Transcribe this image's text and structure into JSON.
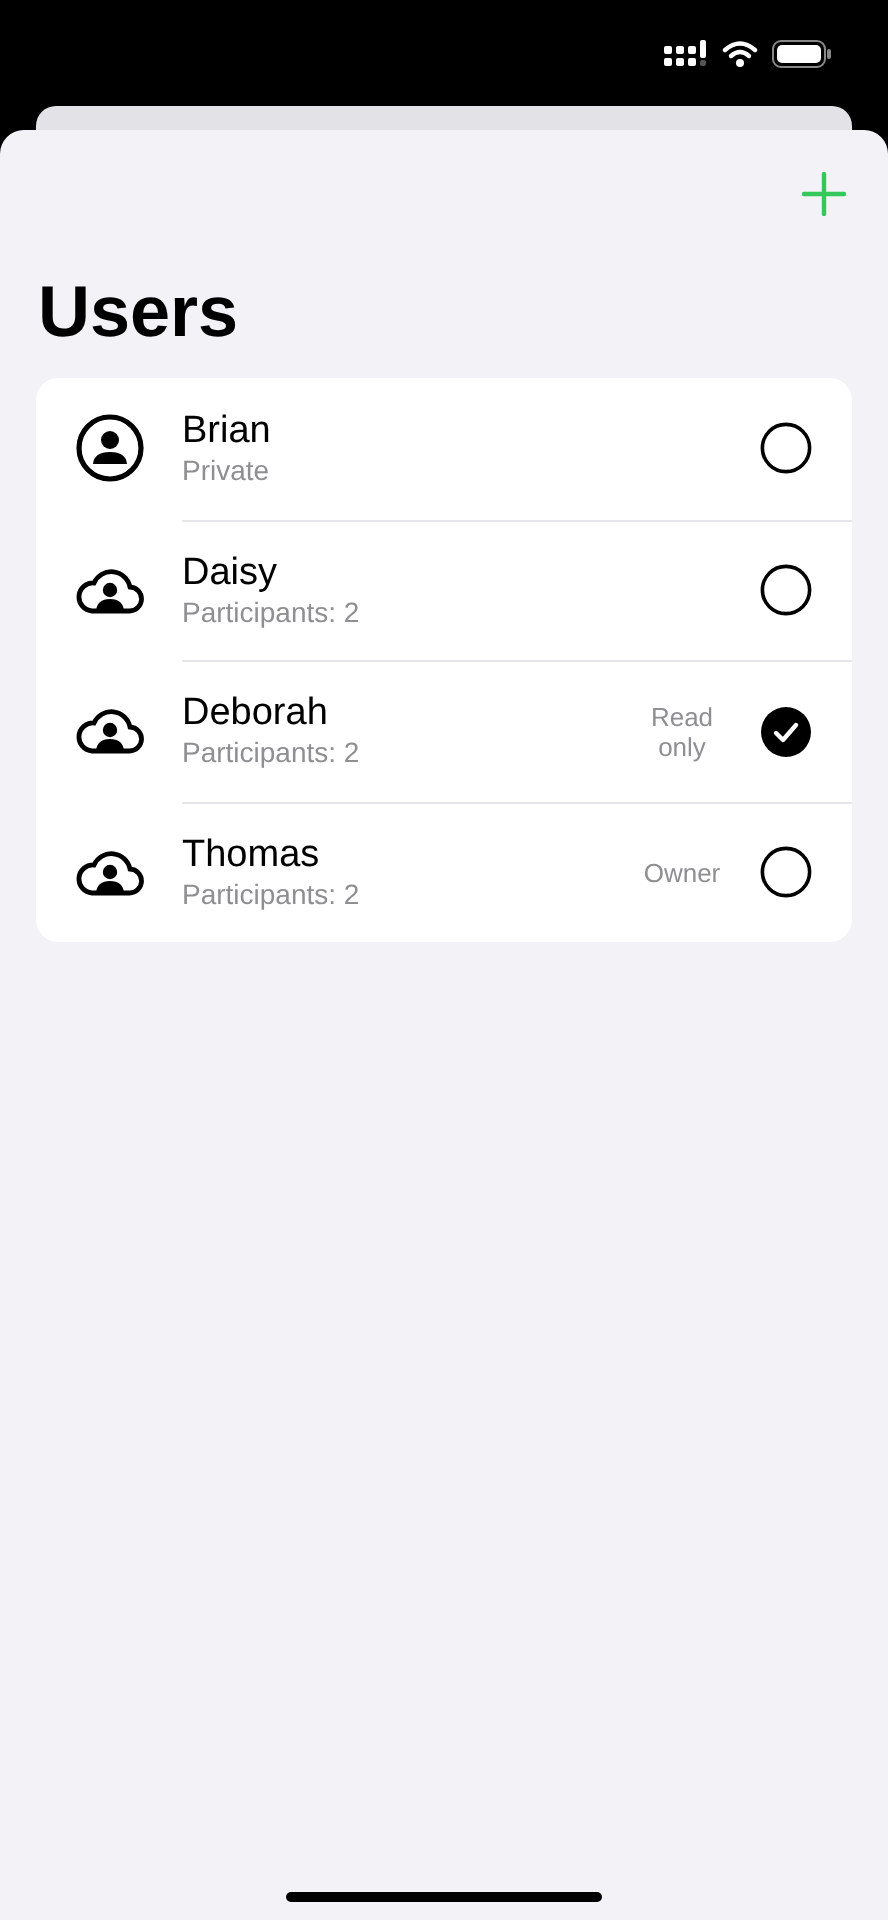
{
  "title": "Users",
  "users": [
    {
      "kind": "person",
      "name": "Brian",
      "detail": "Private",
      "selected": false
    },
    {
      "kind": "cloud",
      "name": "Daisy",
      "detail": "Participants: 2",
      "selected": false
    },
    {
      "kind": "cloud",
      "name": "Deborah",
      "detail": "Participants: 2",
      "role": "Read only",
      "selected": true
    },
    {
      "kind": "cloud",
      "name": "Thomas",
      "detail": "Participants: 2",
      "role": "Owner",
      "selected": false
    }
  ]
}
